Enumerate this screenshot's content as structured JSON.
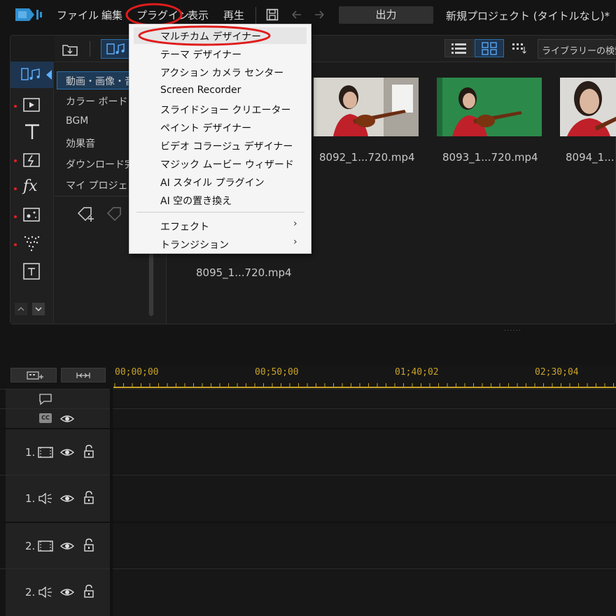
{
  "menubar": {
    "items": [
      "ファイル",
      "編集",
      "プラグイン",
      "表示",
      "再生"
    ],
    "output_label": "出力",
    "title": "新規プロジェクト (タイトルなし)*"
  },
  "library": {
    "search_label": "ライブラリーの検索",
    "tree": [
      "動画・画像・音",
      "カラー ボード",
      "BGM",
      "効果音",
      "ダウンロード完了",
      "マイ プロジェクト"
    ],
    "media": [
      {
        "label": "8092_1...720.mp4"
      },
      {
        "label": "8093_1...720.mp4"
      },
      {
        "label": "8094_1..."
      },
      {
        "label": "8095_1...720.mp4"
      }
    ]
  },
  "plugin_menu": {
    "items": [
      "マルチカム デザイナー",
      "テーマ デザイナー",
      "アクション カメラ センター",
      "Screen Recorder",
      "スライドショー クリエーター",
      "ペイント デザイナー",
      "ビデオ コラージュ デザイナー",
      "マジック ムービー ウィザード",
      "AI スタイル プラグイン",
      "AI 空の置き換え"
    ],
    "submenus": [
      "エフェクト",
      "トランジション"
    ],
    "highlighted": "マルチカム デザイナー"
  },
  "timeline": {
    "ruler": [
      "00;00;00",
      "00;50;00",
      "01;40;02",
      "02;30;04"
    ],
    "tracks": [
      "1.",
      "1.",
      "2.",
      "2."
    ]
  },
  "colors": {
    "annotation_red": "#e01c1c",
    "accent_blue": "#2c6ea8",
    "ruler_gold": "#c9a227"
  }
}
